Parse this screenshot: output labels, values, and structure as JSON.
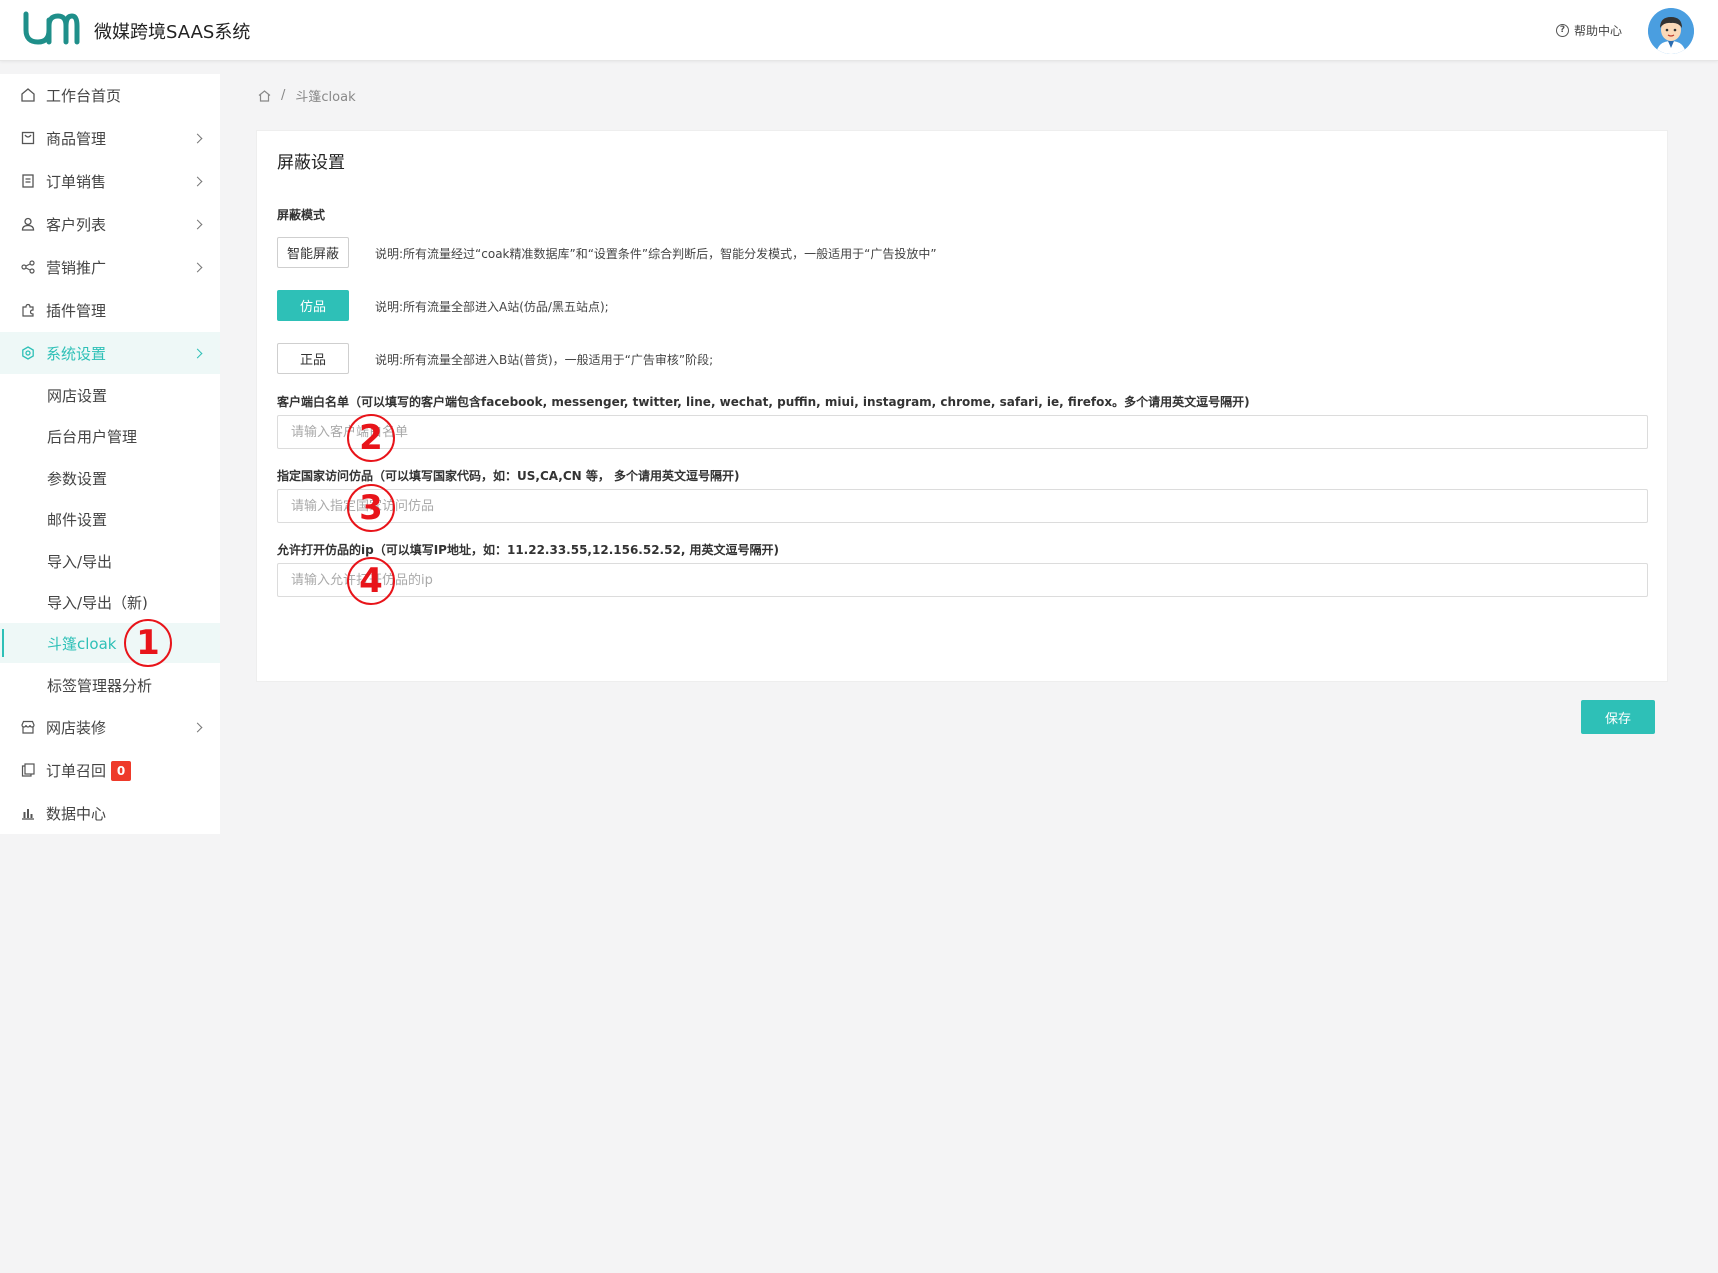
{
  "header": {
    "app_title": "微媒跨境SAAS系统",
    "help_label": "帮助中心",
    "logo_icon": "um-logo-icon",
    "accent_color": "#2ec0b7"
  },
  "sidebar": {
    "items": [
      {
        "label": "工作台首页",
        "icon": "home-icon"
      },
      {
        "label": "商品管理",
        "icon": "bag-icon"
      },
      {
        "label": "订单销售",
        "icon": "document-icon"
      },
      {
        "label": "客户列表",
        "icon": "user-icon"
      },
      {
        "label": "营销推广",
        "icon": "share-icon"
      },
      {
        "label": "插件管理",
        "icon": "puzzle-icon"
      },
      {
        "label": "系统设置",
        "icon": "gear-icon"
      },
      {
        "label": "网店装修",
        "icon": "store-icon"
      },
      {
        "label": "订单召回",
        "icon": "copy-icon",
        "badge": "0"
      },
      {
        "label": "数据中心",
        "icon": "bar-chart-icon"
      }
    ],
    "sub_items": [
      {
        "label": "网店设置"
      },
      {
        "label": "后台用户管理"
      },
      {
        "label": "参数设置"
      },
      {
        "label": "邮件设置"
      },
      {
        "label": "导入/导出"
      },
      {
        "label": "导入/导出（新)"
      },
      {
        "label": "斗篷cloak"
      },
      {
        "label": "标签管理器分析"
      }
    ]
  },
  "breadcrumb": {
    "separator": "/",
    "current": "斗篷cloak"
  },
  "card": {
    "title": "屏蔽设置",
    "mode_label": "屏蔽模式",
    "modes": [
      {
        "label": "智能屏蔽",
        "desc": "说明:所有流量经过“coak精准数据库”和“设置条件”综合判断后，智能分发模式，一般适用于“广告投放中”"
      },
      {
        "label": "仿品",
        "desc": "说明:所有流量全部进入A站(仿品/黑五站点);",
        "selected": true
      },
      {
        "label": "正品",
        "desc": "说明:所有流量全部进入B站(普货)，一般适用于“广告审核”阶段;"
      }
    ],
    "whitelist_label": "客户端白名单（可以填写的客户端包含facebook, messenger, twitter, line, wechat, puffin, miui, instagram, chrome, safari, ie, firefox。多个请用英文逗号隔开)",
    "whitelist_value": "",
    "whitelist_placeholder": "请输入客户端白名单",
    "country_label": "指定国家访问仿品（可以填写国家代码，如：US,CA,CN 等， 多个请用英文逗号隔开)",
    "country_value": "",
    "country_placeholder": "请输入指定国家访问仿品",
    "ip_label": "允许打开仿品的ip（可以填写IP地址，如：11.22.33.55,12.156.52.52, 用英文逗号隔开)",
    "ip_value": "",
    "ip_placeholder": "请输入允许打开仿品的ip"
  },
  "save_label": "保存",
  "annotations": [
    "1",
    "2",
    "3",
    "4"
  ]
}
